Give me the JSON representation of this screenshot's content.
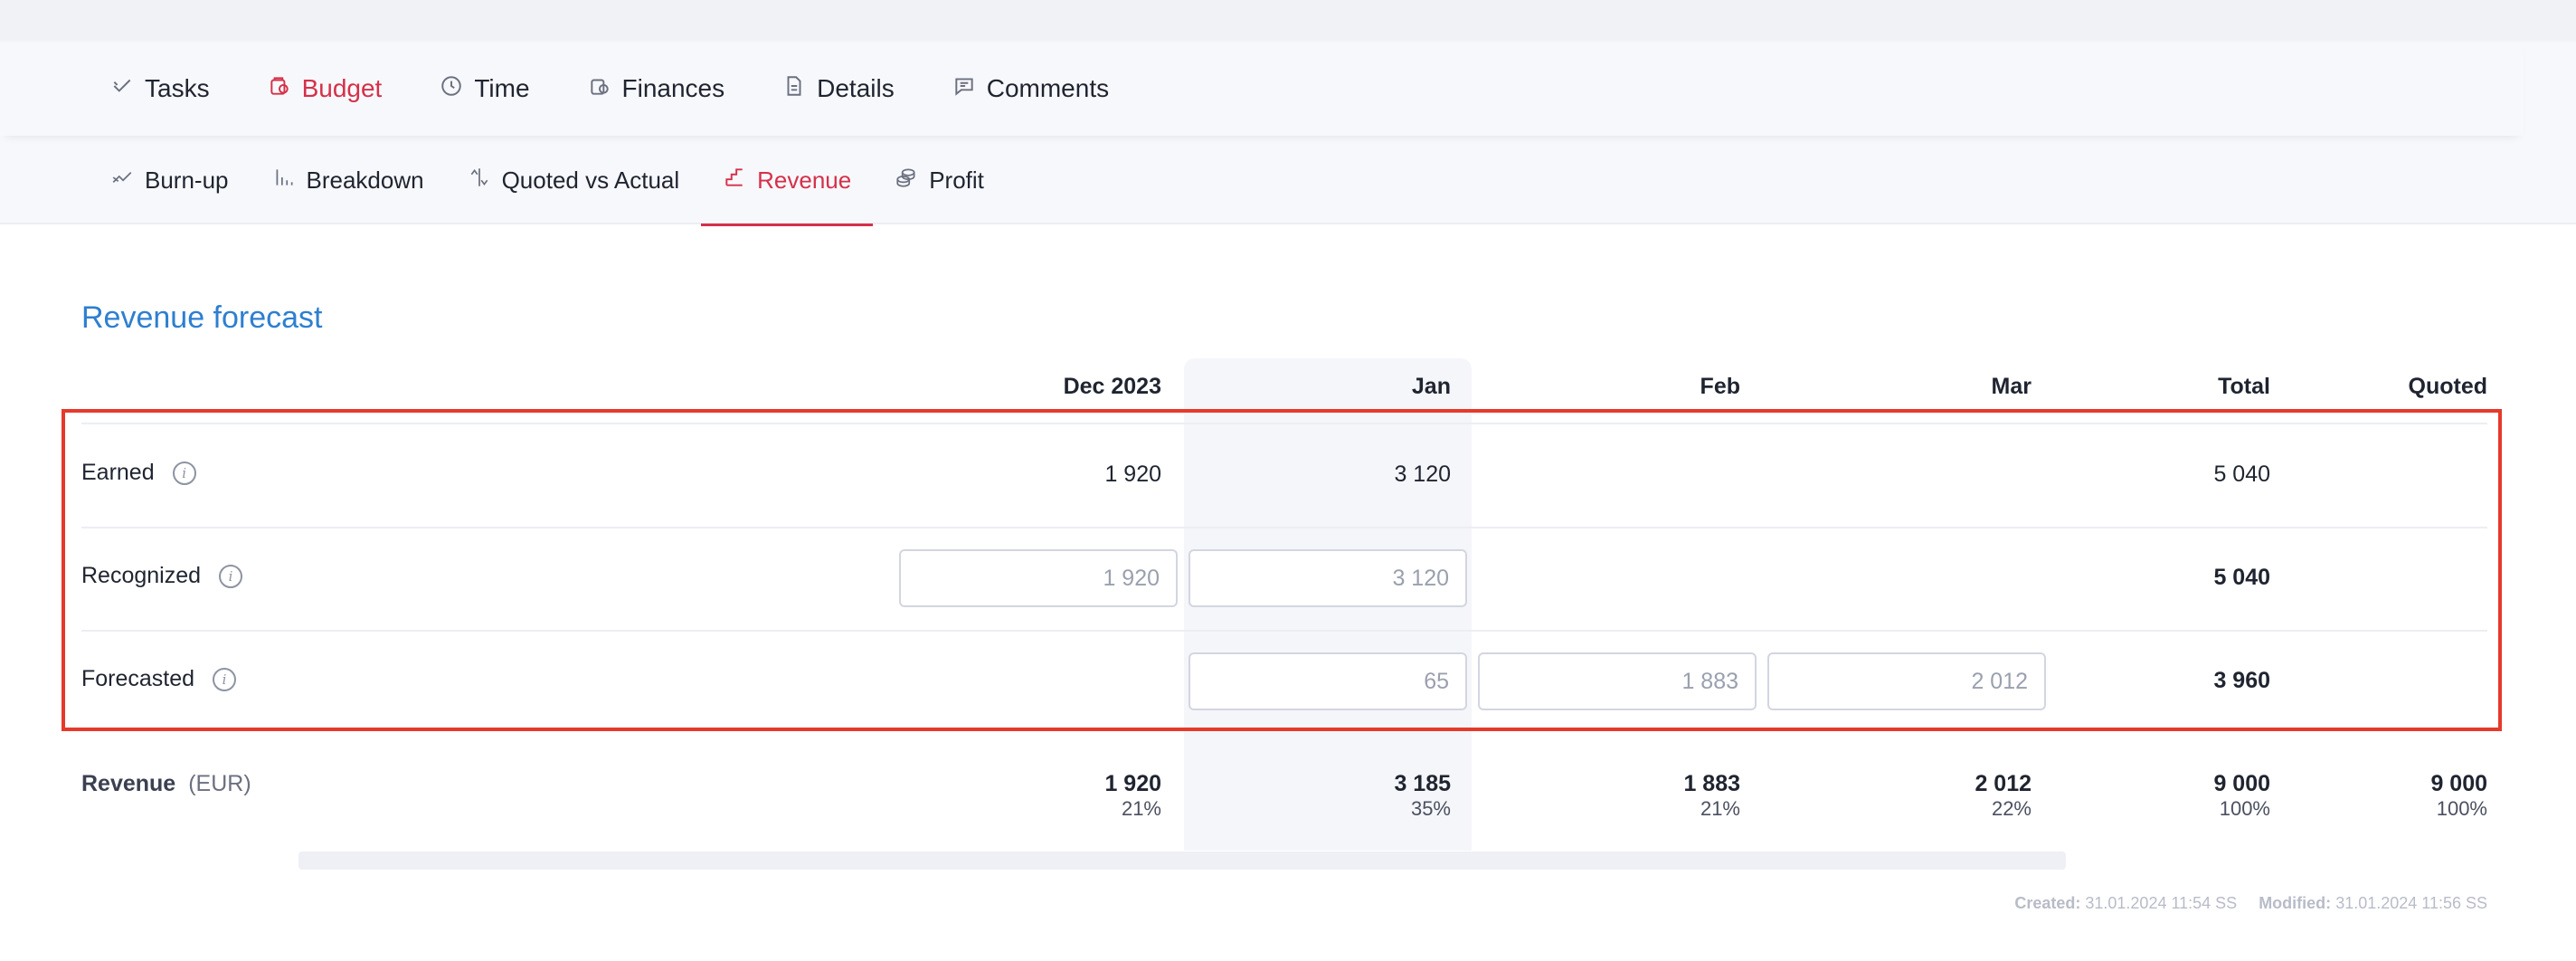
{
  "main_tabs": [
    {
      "label": "Tasks",
      "icon": "check-icon",
      "active": false
    },
    {
      "label": "Budget",
      "icon": "budget-icon",
      "active": true
    },
    {
      "label": "Time",
      "icon": "clock-icon",
      "active": false
    },
    {
      "label": "Finances",
      "icon": "coins-icon",
      "active": false
    },
    {
      "label": "Details",
      "icon": "document-icon",
      "active": false
    },
    {
      "label": "Comments",
      "icon": "comment-icon",
      "active": false
    }
  ],
  "sub_tabs": [
    {
      "label": "Burn-up",
      "icon": "burnup-icon",
      "active": false
    },
    {
      "label": "Breakdown",
      "icon": "bar-chart-icon",
      "active": false
    },
    {
      "label": "Quoted vs Actual",
      "icon": "compare-icon",
      "active": false
    },
    {
      "label": "Revenue",
      "icon": "revenue-icon",
      "active": true
    },
    {
      "label": "Profit",
      "icon": "profit-icon",
      "active": false
    }
  ],
  "section_title": "Revenue forecast",
  "columns": [
    "Dec 2023",
    "Jan",
    "Feb",
    "Mar",
    "Total",
    "Quoted"
  ],
  "rows": {
    "earned": {
      "label": "Earned",
      "dec": "1 920",
      "jan": "3 120",
      "total": "5 040"
    },
    "recognized": {
      "label": "Recognized",
      "dec": "1 920",
      "jan": "3 120",
      "total": "5 040"
    },
    "forecasted": {
      "label": "Forecasted",
      "jan": "65",
      "feb": "1 883",
      "mar": "2 012",
      "total": "3 960"
    }
  },
  "revenue": {
    "label": "Revenue",
    "unit": "(EUR)",
    "dec": "1 920",
    "dec_pct": "21%",
    "jan": "3 185",
    "jan_pct": "35%",
    "feb": "1 883",
    "feb_pct": "21%",
    "mar": "2 012",
    "mar_pct": "22%",
    "total": "9 000",
    "total_pct": "100%",
    "quoted": "9 000",
    "quoted_pct": "100%"
  },
  "footer": {
    "created_label": "Created:",
    "created_value": "31.01.2024 11:54 SS",
    "modified_label": "Modified:",
    "modified_value": "31.01.2024 11:56 SS"
  },
  "colors": {
    "accent": "#d5304a",
    "title": "#2e7fd0",
    "highlight": "#e53a2b"
  }
}
